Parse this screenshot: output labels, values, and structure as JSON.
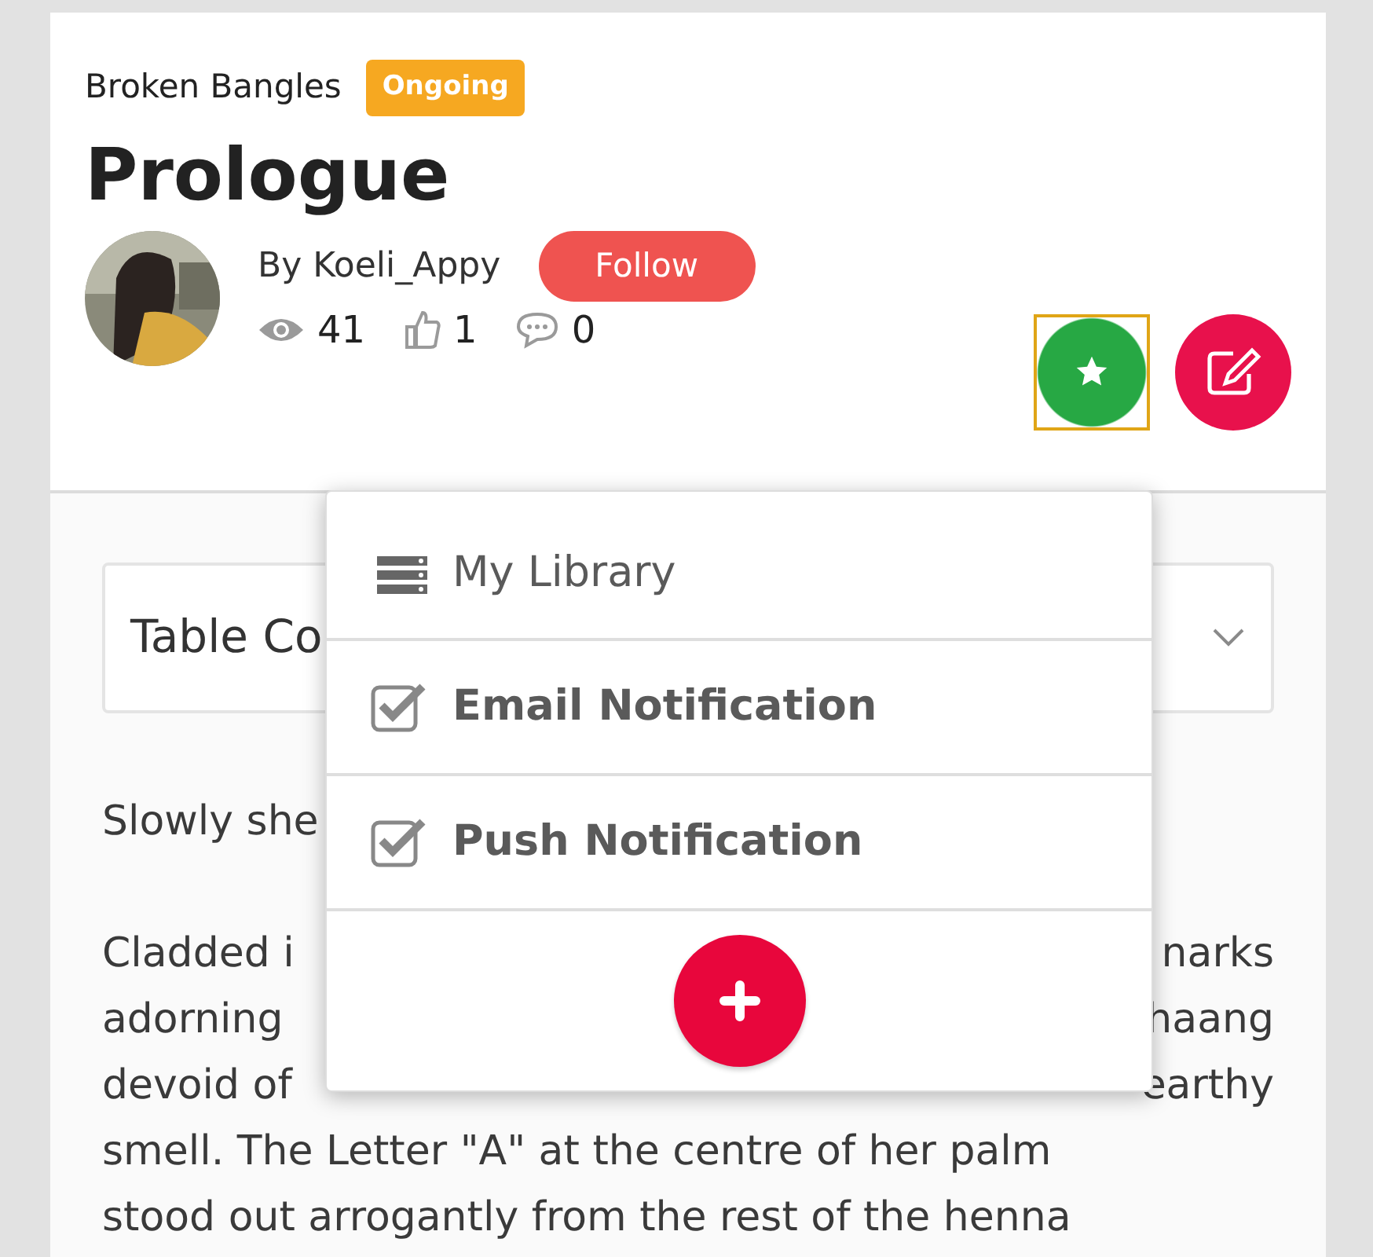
{
  "story": {
    "title": "Broken Bangles",
    "status": "Ongoing"
  },
  "chapter": {
    "title": "Prologue"
  },
  "author": {
    "byline": "By Koeli_Appy",
    "follow_button": "Follow"
  },
  "stats": [
    {
      "kind": "views",
      "value": "41"
    },
    {
      "kind": "likes",
      "value": "1"
    },
    {
      "kind": "comments",
      "value": "0"
    }
  ],
  "actions": [
    {
      "kind": "star",
      "focused": true
    },
    {
      "kind": "edit",
      "focused": false
    }
  ],
  "table_of_contents": {
    "label": "Table Co"
  },
  "paragraphs": [
    {
      "lines": [
        {
          "left": "Slowly she"
        }
      ]
    },
    {
      "lines": [
        {
          "left": "Cladded i",
          "right": "narks"
        },
        {
          "left": "adorning",
          "right": "haang"
        },
        {
          "left": "devoid of",
          "right": "earthy"
        },
        {
          "text": "smell. The Letter \"A\" at the centre of her palm"
        },
        {
          "text": "stood out arrogantly from the rest of the henna"
        }
      ]
    }
  ],
  "menu": {
    "items": [
      {
        "kind": "link",
        "label": "My Library"
      },
      {
        "kind": "check",
        "label": "Email Notification",
        "checked": true
      },
      {
        "kind": "check",
        "label": "Push Notification",
        "checked": true
      }
    ]
  }
}
